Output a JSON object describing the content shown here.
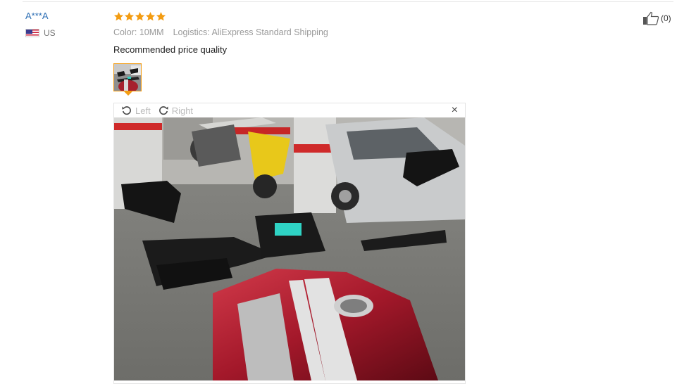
{
  "reviewer": {
    "name": "A***A",
    "country": "US",
    "flag_icon": "us-flag-icon"
  },
  "review": {
    "rating": 5,
    "star_color": "#f39c12",
    "color_label": "Color:",
    "color_value": "10MM",
    "logistics_label": "Logistics:",
    "logistics_value": "AliExpress Standard Shipping",
    "text": "Recommended price quality"
  },
  "helpful": {
    "icon": "thumbs-up-icon",
    "count": "(0)"
  },
  "viewer": {
    "rotate_left_label": "Left",
    "rotate_right_label": "Right",
    "close_label": "×",
    "accent": "#f39c12"
  }
}
